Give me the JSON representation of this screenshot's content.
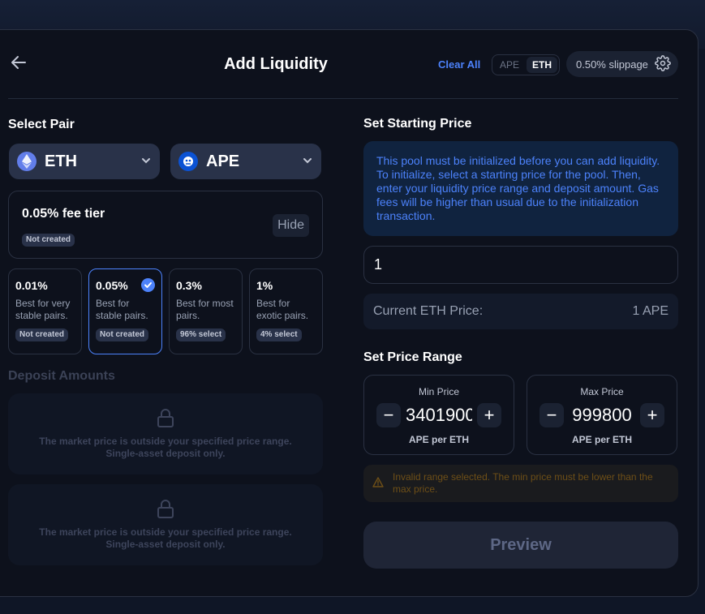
{
  "header": {
    "title": "Add Liquidity",
    "clear_all": "Clear All",
    "toggle": [
      "APE",
      "ETH"
    ],
    "toggle_active": "ETH",
    "slippage": "0.50% slippage"
  },
  "select_pair": {
    "heading": "Select Pair",
    "token_a": "ETH",
    "token_b": "APE"
  },
  "fee": {
    "selected_label": "0.05% fee tier",
    "selected_status": "Not created",
    "hide_label": "Hide",
    "tiers": [
      {
        "pct": "0.01%",
        "desc": "Best for very stable pairs.",
        "badge": "Not created"
      },
      {
        "pct": "0.05%",
        "desc": "Best for stable pairs.",
        "badge": "Not created"
      },
      {
        "pct": "0.3%",
        "desc": "Best for most pairs.",
        "badge": "96% select"
      },
      {
        "pct": "1%",
        "desc": "Best for exotic pairs.",
        "badge": "4% select"
      }
    ]
  },
  "deposit": {
    "heading": "Deposit Amounts",
    "locked_text": "The market price is outside your specified price range. Single-asset deposit only."
  },
  "starting_price": {
    "heading": "Set Starting Price",
    "info": "This pool must be initialized before you can add liquidity. To initialize, select a starting price for the pool. Then, enter your liquidity price range and deposit amount. Gas fees will be higher than usual due to the initialization transaction.",
    "input_value": "1",
    "current_label": "Current ETH Price:",
    "current_value": "1 APE"
  },
  "price_range": {
    "heading": "Set Price Range",
    "min_label": "Min Price",
    "min_value": "3401900",
    "max_label": "Max Price",
    "max_value": "999800",
    "unit": "APE per ETH",
    "warning": "Invalid range selected. The min price must be lower than the max price."
  },
  "preview_label": "Preview",
  "colors": {
    "accent": "#4c82fb",
    "background": "#0d111c",
    "warning": "#6e4f17"
  }
}
